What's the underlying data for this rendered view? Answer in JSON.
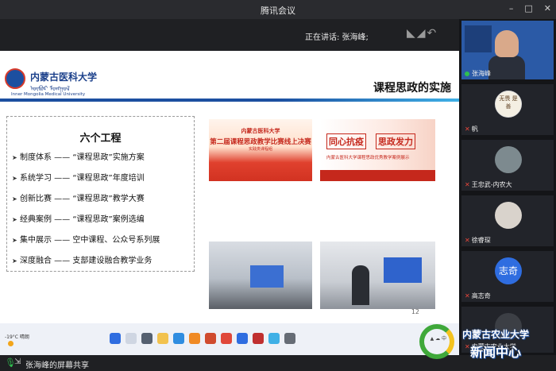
{
  "window": {
    "title": "腾讯会议",
    "controls": [
      "–",
      "□",
      "✕"
    ]
  },
  "speaking": {
    "text": "正在讲话: 张海峰;"
  },
  "slide": {
    "logo_cn": "内蒙古医科大学",
    "logo_mn": "ᠥᠪᠦᠷ ᠮᠣᠩᠭᠣᠯ",
    "logo_en": "Inner Mongolia Medical University",
    "title": "课程思政的实施",
    "projects_title": "六个工程",
    "projects": [
      "制度体系 —— “课程思政”实施方案",
      "系统学习 —— “课程思政”年度培训",
      "创新比赛 —— “课程思政”教学大赛",
      "经典案例 —— “课程思政”案例选编",
      "集中展示 —— 空中课程、公众号系列展",
      "深度融合 —— 支部建设融合教学业务"
    ],
    "pic1": {
      "line1": "内蒙古医科大学",
      "line2": "第二届课程思政教学比赛线上决赛",
      "line3": "实践类课程组"
    },
    "pic2": {
      "tag1": "同心抗疫",
      "tag2": "思政发力",
      "caption": "内蒙古医科大学课程思政优秀教学案例展示"
    },
    "page_number": "12"
  },
  "taskbar": {
    "weather": "-19°C 晴朗"
  },
  "participants": [
    {
      "name": "张海峰",
      "muted": false,
      "speaking": true
    },
    {
      "name": "帆",
      "muted": true,
      "avatar_text": "无畏 是 善"
    },
    {
      "name": "王忠武-内农大",
      "muted": true
    },
    {
      "name": "徐睿琛",
      "muted": true
    },
    {
      "name": "高志奇",
      "muted": true,
      "avatar_text": "志奇"
    },
    {
      "name": "内蒙古农业大学",
      "muted": true
    }
  ],
  "watermark": {
    "line1": "内蒙古农业大学",
    "line2": "新闻中心"
  },
  "footer": {
    "share_text": "张海峰的屏幕共享"
  }
}
